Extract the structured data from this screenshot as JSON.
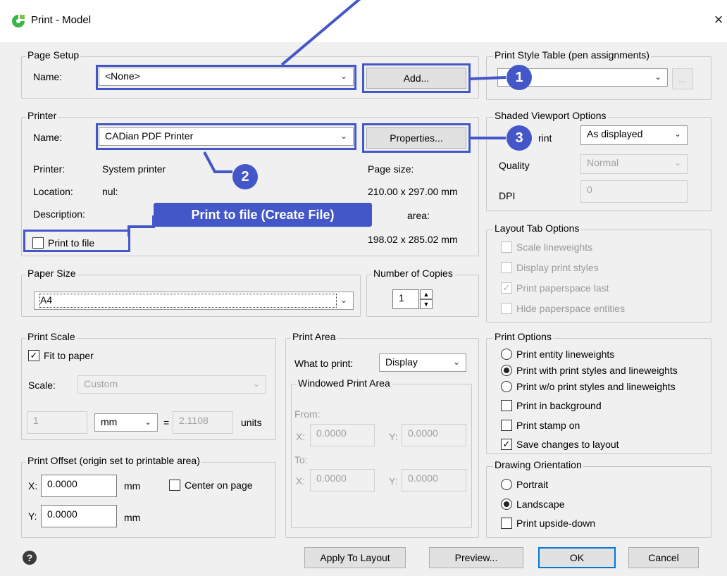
{
  "window": {
    "title": "Print - Model",
    "close_glyph": "×"
  },
  "page_setup": {
    "group_label": "Page Setup",
    "name_label": "Name:",
    "name_value": "<None>",
    "add_button": "Add..."
  },
  "printer": {
    "group_label": "Printer",
    "name_label": "Name:",
    "name_value": "CADian PDF Printer",
    "properties_button": "Properties...",
    "printer_label": "Printer:",
    "printer_value": "System printer",
    "location_label": "Location:",
    "location_value": "nul:",
    "description_label": "Description:",
    "page_size_label": "Page size:",
    "page_size_value": "210.00 x 297.00 mm",
    "printable_area_label": "area:",
    "printable_area_value": "198.02 x 285.02 mm",
    "print_to_file_label": "Print to file"
  },
  "paper_size": {
    "group_label": "Paper Size",
    "value": "A4"
  },
  "copies": {
    "label": "Number of Copies",
    "value": "1"
  },
  "print_scale": {
    "group_label": "Print Scale",
    "fit_to_paper_label": "Fit to paper",
    "scale_label": "Scale:",
    "scale_value": "Custom",
    "left_value": "1",
    "unit_value": "mm",
    "equals": "=",
    "right_value": "2.1108",
    "units_label": "units"
  },
  "print_offset": {
    "group_label": "Print Offset (origin set to printable area)",
    "x_label": "X:",
    "x_value": "0.0000",
    "x_unit": "mm",
    "y_label": "Y:",
    "y_value": "0.0000",
    "y_unit": "mm",
    "center_label": "Center on page"
  },
  "print_area": {
    "group_label": "Print Area",
    "what_label": "What to print:",
    "what_value": "Display",
    "windowed_label": "Windowed Print Area",
    "from_label": "From:",
    "to_label": "To:",
    "fx_label": "X:",
    "fx_value": "0.0000",
    "fy_label": "Y:",
    "fy_value": "0.0000",
    "tx_label": "X:",
    "tx_value": "0.0000",
    "ty_label": "Y:",
    "ty_value": "0.0000"
  },
  "style_table": {
    "group_label": "Print Style Table (pen assignments)",
    "value": "",
    "edit_button": "..."
  },
  "shaded": {
    "group_label": "Shaded Viewport Options",
    "shade_label_tail": "rint",
    "shade_value": "As displayed",
    "quality_label": "Quality",
    "quality_value": "Normal",
    "dpi_label": "DPI",
    "dpi_value": "0"
  },
  "layout_tab": {
    "group_label": "Layout Tab Options",
    "scale_lw": "Scale lineweights",
    "display_styles": "Display print styles",
    "paperspace_last": "Print paperspace last",
    "hide_paperspace": "Hide paperspace entities"
  },
  "print_options": {
    "group_label": "Print Options",
    "entity_lw": "Print entity lineweights",
    "with_styles": "Print with print styles and lineweights",
    "without_styles": "Print w/o print styles and lineweights",
    "background": "Print in background",
    "stamp": "Print stamp on",
    "save_changes": "Save changes to layout"
  },
  "orientation": {
    "group_label": "Drawing Orientation",
    "portrait": "Portrait",
    "landscape": "Landscape",
    "upside_down": "Print upside-down"
  },
  "buttons": {
    "help": "?",
    "apply": "Apply To Layout",
    "preview": "Preview...",
    "ok": "OK",
    "cancel": "Cancel"
  },
  "annotations": {
    "badge1": "1",
    "badge2": "2",
    "badge3": "3",
    "banner": "Print to file (Create File)",
    "accent": "#4457c8"
  }
}
